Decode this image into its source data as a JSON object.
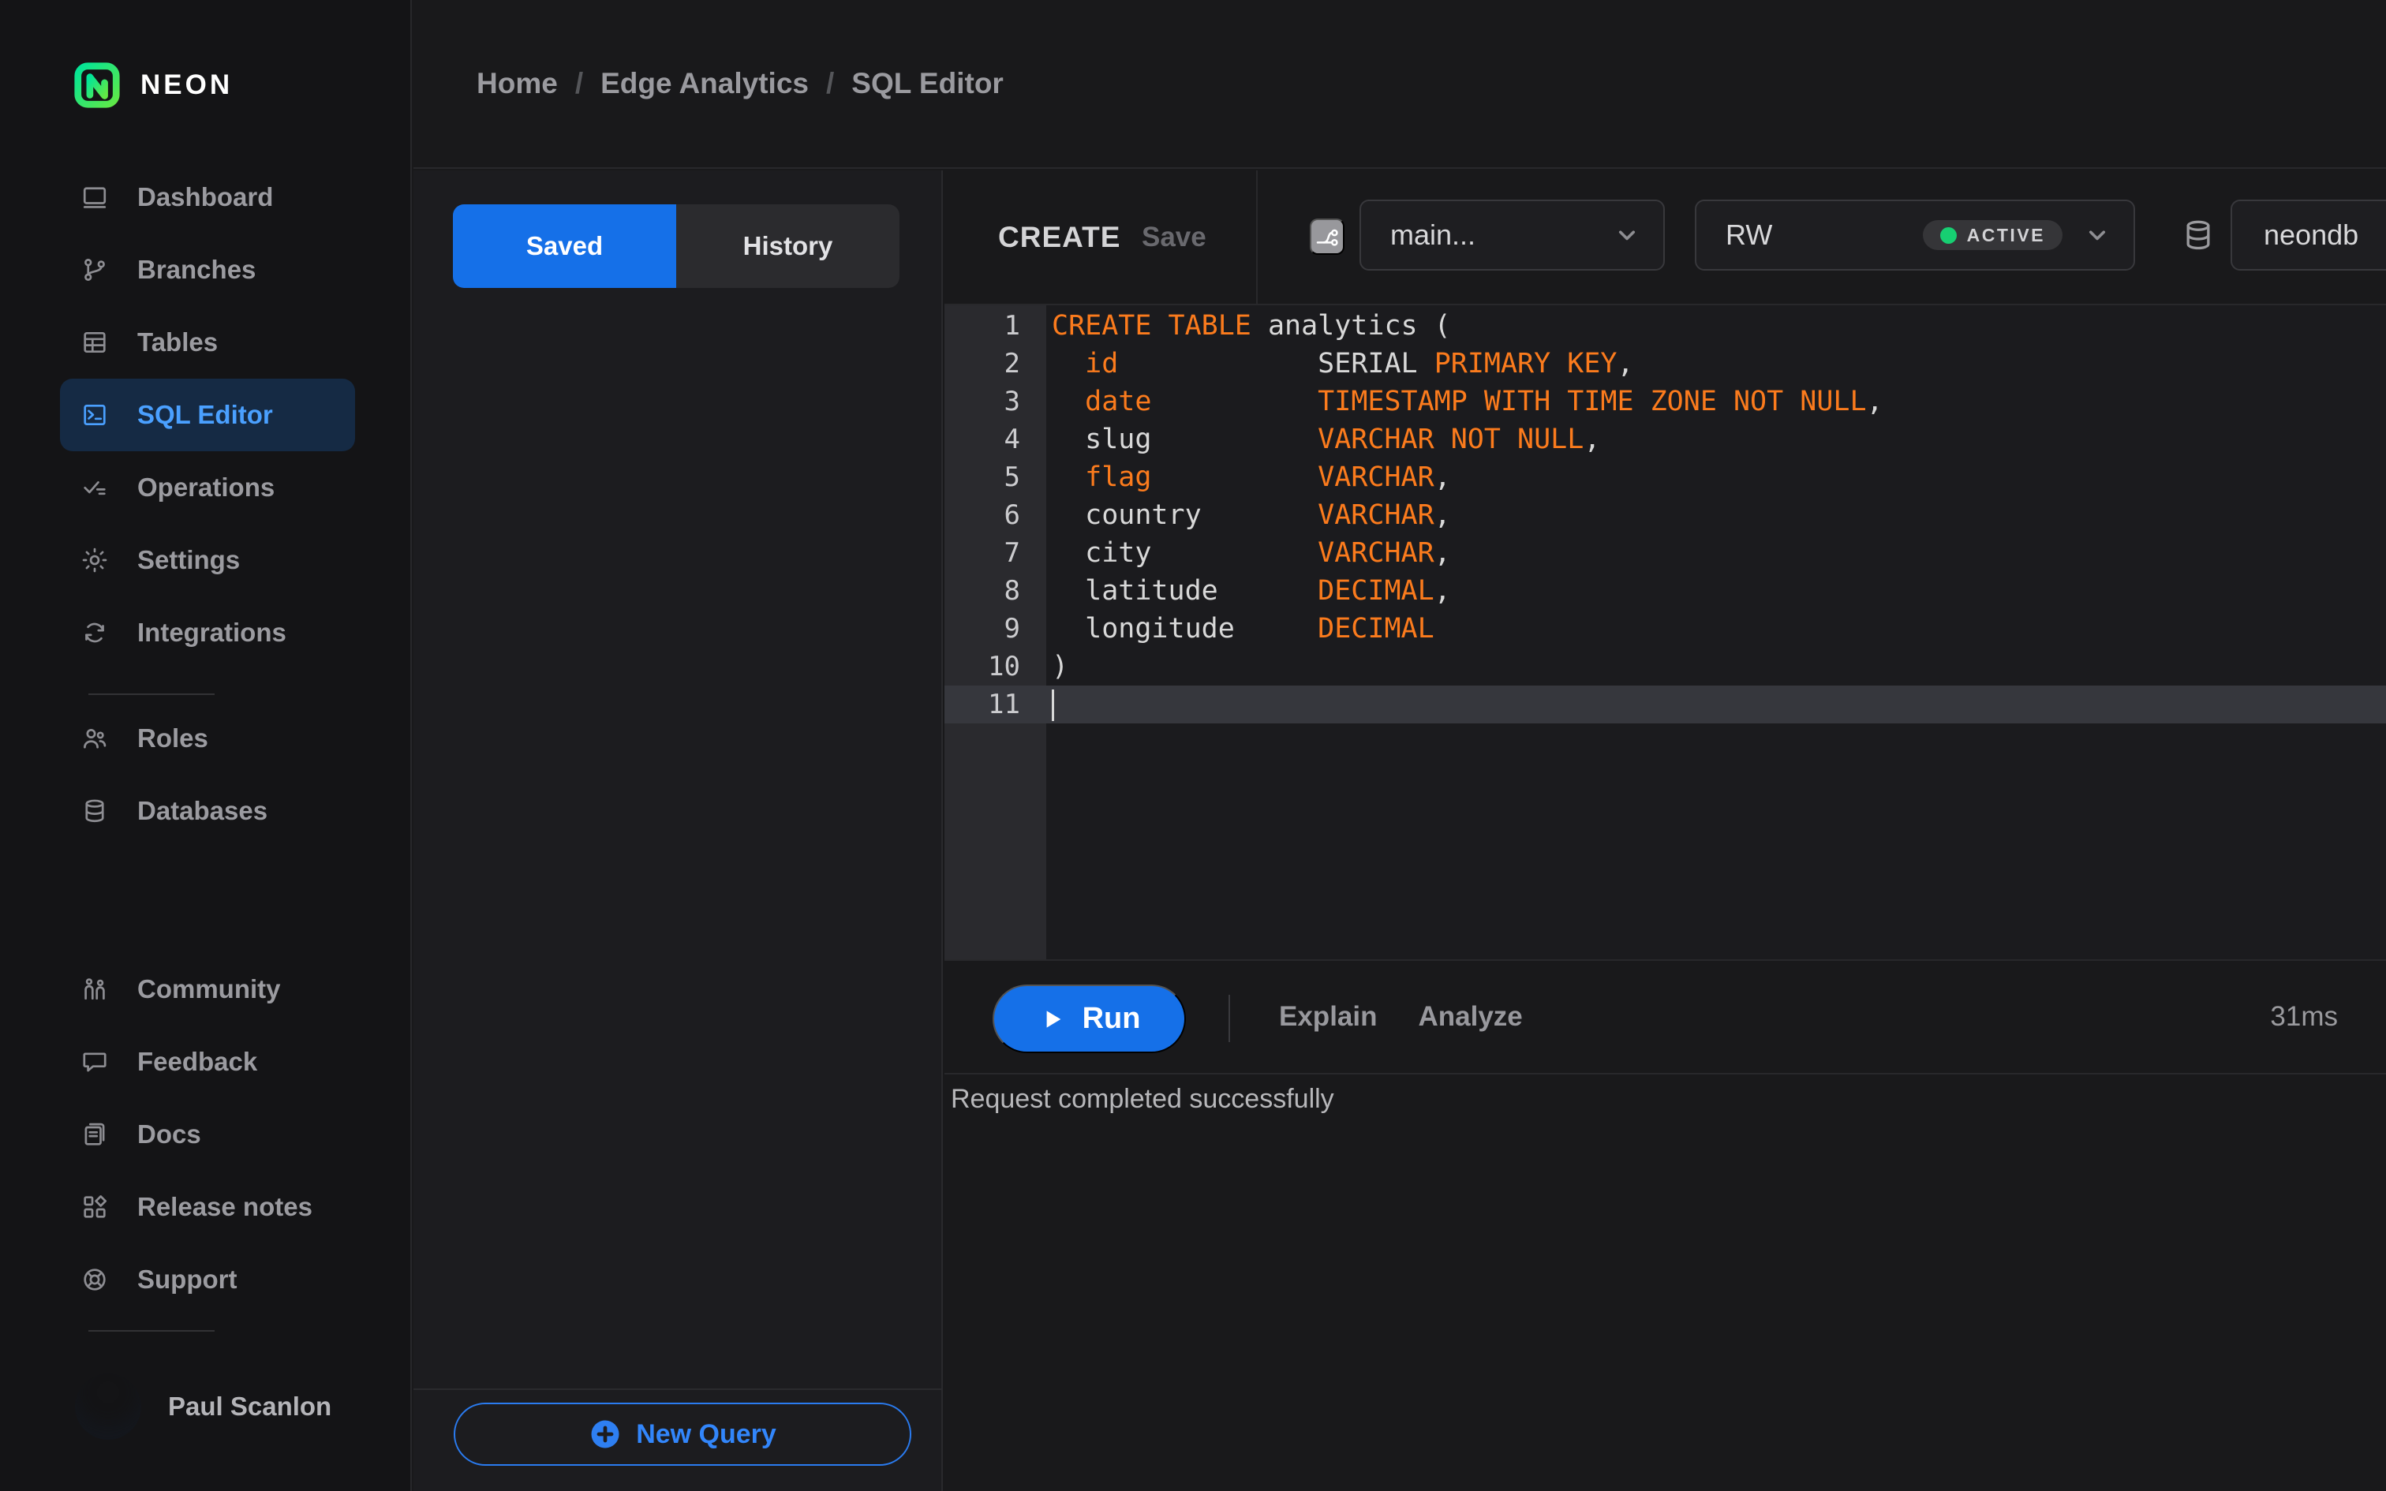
{
  "brand": {
    "name": "NEON"
  },
  "sidebar": {
    "groups": [
      {
        "items": [
          {
            "label": "Dashboard",
            "icon": "dashboard",
            "active": false
          },
          {
            "label": "Branches",
            "icon": "branches",
            "active": false
          },
          {
            "label": "Tables",
            "icon": "tables",
            "active": false
          },
          {
            "label": "SQL Editor",
            "icon": "sql-editor",
            "active": true
          },
          {
            "label": "Operations",
            "icon": "operations",
            "active": false
          },
          {
            "label": "Settings",
            "icon": "settings",
            "active": false
          },
          {
            "label": "Integrations",
            "icon": "integrations",
            "active": false
          }
        ]
      },
      {
        "items": [
          {
            "label": "Roles",
            "icon": "roles",
            "active": false
          },
          {
            "label": "Databases",
            "icon": "databases",
            "active": false
          }
        ]
      },
      {
        "items": [
          {
            "label": "Community",
            "icon": "community",
            "active": false
          },
          {
            "label": "Feedback",
            "icon": "feedback",
            "active": false
          },
          {
            "label": "Docs",
            "icon": "docs",
            "active": false
          },
          {
            "label": "Release notes",
            "icon": "release-notes",
            "active": false
          },
          {
            "label": "Support",
            "icon": "support",
            "active": false
          }
        ]
      }
    ],
    "user": {
      "name": "Paul Scanlon"
    }
  },
  "breadcrumb": {
    "separator": "/",
    "items": [
      "Home",
      "Edge Analytics",
      "SQL Editor"
    ]
  },
  "queries_panel": {
    "tabs": [
      {
        "label": "Saved",
        "active": true
      },
      {
        "label": "History",
        "active": false
      }
    ],
    "new_query_label": "New Query"
  },
  "editor_header": {
    "query_title": "CREATE",
    "save_label": "Save",
    "branch_selector": "main...",
    "compute": "RW",
    "compute_status": "ACTIVE",
    "database": "neondb"
  },
  "code": {
    "active_line": 11,
    "lines": [
      {
        "tokens": [
          [
            "CREATE TABLE",
            "k"
          ],
          [
            " analytics (",
            "d"
          ]
        ]
      },
      {
        "tokens": [
          [
            "  ",
            "d"
          ],
          [
            "id",
            "k"
          ],
          [
            "            SERIAL ",
            "d"
          ],
          [
            "PRIMARY KEY",
            "k"
          ],
          [
            ",",
            "d"
          ]
        ]
      },
      {
        "tokens": [
          [
            "  ",
            "d"
          ],
          [
            "date",
            "k"
          ],
          [
            "          ",
            "d"
          ],
          [
            "TIMESTAMP WITH TIME ZONE NOT NULL",
            "k"
          ],
          [
            ",",
            "d"
          ]
        ]
      },
      {
        "tokens": [
          [
            "  slug          ",
            "d"
          ],
          [
            "VARCHAR NOT NULL",
            "k"
          ],
          [
            ",",
            "d"
          ]
        ]
      },
      {
        "tokens": [
          [
            "  ",
            "d"
          ],
          [
            "flag",
            "k"
          ],
          [
            "          ",
            "d"
          ],
          [
            "VARCHAR",
            "k"
          ],
          [
            ",",
            "d"
          ]
        ]
      },
      {
        "tokens": [
          [
            "  country       ",
            "d"
          ],
          [
            "VARCHAR",
            "k"
          ],
          [
            ",",
            "d"
          ]
        ]
      },
      {
        "tokens": [
          [
            "  city          ",
            "d"
          ],
          [
            "VARCHAR",
            "k"
          ],
          [
            ",",
            "d"
          ]
        ]
      },
      {
        "tokens": [
          [
            "  latitude      ",
            "d"
          ],
          [
            "DECIMAL",
            "k"
          ],
          [
            ",",
            "d"
          ]
        ]
      },
      {
        "tokens": [
          [
            "  longitude     ",
            "d"
          ],
          [
            "DECIMAL",
            "k"
          ]
        ]
      },
      {
        "tokens": [
          [
            ")",
            "d"
          ]
        ]
      },
      {
        "tokens": []
      }
    ]
  },
  "run_bar": {
    "run_label": "Run",
    "explain_label": "Explain",
    "analyze_label": "Analyze",
    "duration": "31ms"
  },
  "results": {
    "message": "Request completed successfully"
  },
  "colors": {
    "accent_blue": "#1570e8",
    "keyword_orange": "#fb7b1d",
    "status_green": "#17cf72",
    "active_item_blue": "#4aa0ff"
  }
}
